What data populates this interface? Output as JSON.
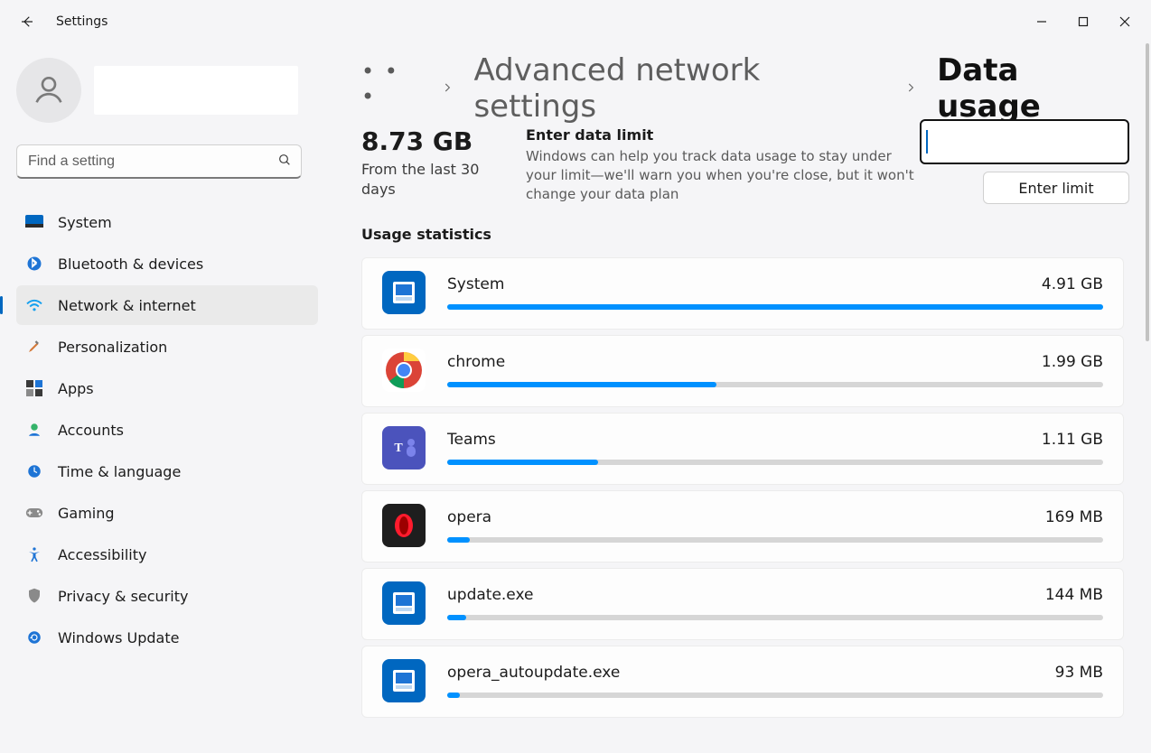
{
  "window": {
    "title": "Settings"
  },
  "search": {
    "placeholder": "Find a setting"
  },
  "sidebar": {
    "items": [
      {
        "label": "System"
      },
      {
        "label": "Bluetooth & devices"
      },
      {
        "label": "Network & internet"
      },
      {
        "label": "Personalization"
      },
      {
        "label": "Apps"
      },
      {
        "label": "Accounts"
      },
      {
        "label": "Time & language"
      },
      {
        "label": "Gaming"
      },
      {
        "label": "Accessibility"
      },
      {
        "label": "Privacy & security"
      },
      {
        "label": "Windows Update"
      }
    ],
    "active_index": 2
  },
  "breadcrumb": {
    "parent": "Advanced network settings",
    "current": "Data usage"
  },
  "total": {
    "value": "8.73 GB",
    "sub": "From the last 30 days"
  },
  "limit": {
    "title": "Enter data limit",
    "desc": "Windows can help you track data usage to stay under your limit—we'll warn you when you're close, but it won't change your data plan",
    "button": "Enter limit"
  },
  "stats_title": "Usage statistics",
  "apps": [
    {
      "name": "System",
      "amount": "4.91 GB",
      "pct": 100
    },
    {
      "name": "chrome",
      "amount": "1.99 GB",
      "pct": 41
    },
    {
      "name": "Teams",
      "amount": "1.11 GB",
      "pct": 23
    },
    {
      "name": "opera",
      "amount": "169 MB",
      "pct": 3.4
    },
    {
      "name": "update.exe",
      "amount": "144 MB",
      "pct": 2.9
    },
    {
      "name": "opera_autoupdate.exe",
      "amount": "93 MB",
      "pct": 1.9
    }
  ],
  "colors": {
    "accent": "#0067c0",
    "bar": "#0091ff"
  }
}
